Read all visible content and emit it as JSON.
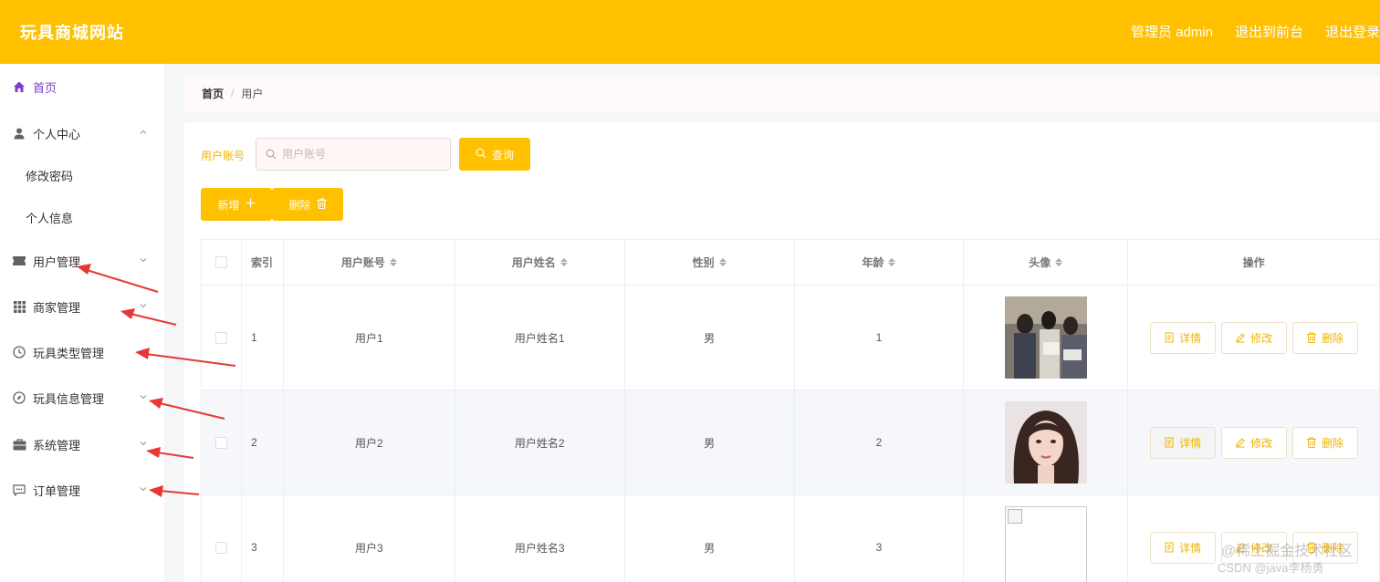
{
  "header": {
    "brand": "玩具商城网站",
    "admin_label": "管理员 admin",
    "to_front": "退出到前台",
    "logout": "退出登录"
  },
  "sidebar": {
    "items": [
      {
        "label": "首页",
        "icon": "home-icon"
      },
      {
        "label": "个人中心",
        "icon": "user-icon"
      },
      {
        "label": "修改密码"
      },
      {
        "label": "个人信息"
      },
      {
        "label": "用户管理",
        "icon": "ticket-icon"
      },
      {
        "label": "商家管理",
        "icon": "grid-icon"
      },
      {
        "label": "玩具类型管理",
        "icon": "clock-icon"
      },
      {
        "label": "玩具信息管理",
        "icon": "compass-icon"
      },
      {
        "label": "系统管理",
        "icon": "briefcase-icon"
      },
      {
        "label": "订单管理",
        "icon": "chat-icon"
      }
    ]
  },
  "breadcrumb": {
    "home": "首页",
    "separator": "/",
    "current": "用户"
  },
  "search": {
    "label": "用户账号",
    "placeholder": "用户账号",
    "button": "查询"
  },
  "actions": {
    "add": "新增",
    "delete": "删除"
  },
  "table": {
    "headers": {
      "index": "索引",
      "account": "用户账号",
      "name": "用户姓名",
      "sex": "性别",
      "age": "年龄",
      "avatar": "头像",
      "ops": "操作"
    },
    "rows": [
      {
        "index": "1",
        "account": "用户1",
        "name": "用户姓名1",
        "sex": "男",
        "age": "1"
      },
      {
        "index": "2",
        "account": "用户2",
        "name": "用户姓名2",
        "sex": "男",
        "age": "2"
      },
      {
        "index": "3",
        "account": "用户3",
        "name": "用户姓名3",
        "sex": "男",
        "age": "3"
      }
    ],
    "op_labels": {
      "detail": "详情",
      "edit": "修改",
      "delete": "删除"
    }
  },
  "colors": {
    "accent": "#ffc000",
    "active_menu": "#7a3fd1",
    "annotation_arrow": "#e53935"
  },
  "watermark": {
    "line1": "@稀土掘金技术社区",
    "line2": "CSDN @java李杨勇"
  }
}
